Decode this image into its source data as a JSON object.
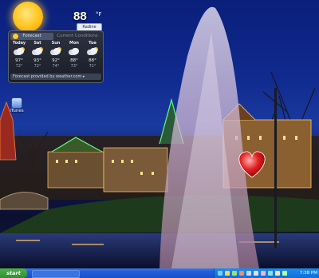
{
  "gadget": {
    "temperature": "88",
    "temperature_unit": "°F",
    "location": "Radine",
    "tabs": [
      "Forecast",
      "Current Conditions"
    ],
    "days": [
      {
        "name": "Today",
        "high": "97°",
        "low": "72°"
      },
      {
        "name": "Sat",
        "high": "93°",
        "low": "72°"
      },
      {
        "name": "Sun",
        "high": "92°",
        "low": "74°"
      },
      {
        "name": "Mon",
        "high": "88°",
        "low": "73°"
      },
      {
        "name": "Tue",
        "high": "88°",
        "low": "71°"
      }
    ],
    "footer": "Forecast provided by weather.com ▸"
  },
  "desktop_icons": [
    {
      "label": "iTunes",
      "icon": "itunes-icon"
    }
  ],
  "taskbar": {
    "start_label": "start",
    "clock": "7:38 PM"
  },
  "colors": {
    "sky": "#102a8f",
    "taskbar": "#245edb",
    "start": "#3a9a38",
    "tray": "#0f6ed8"
  }
}
